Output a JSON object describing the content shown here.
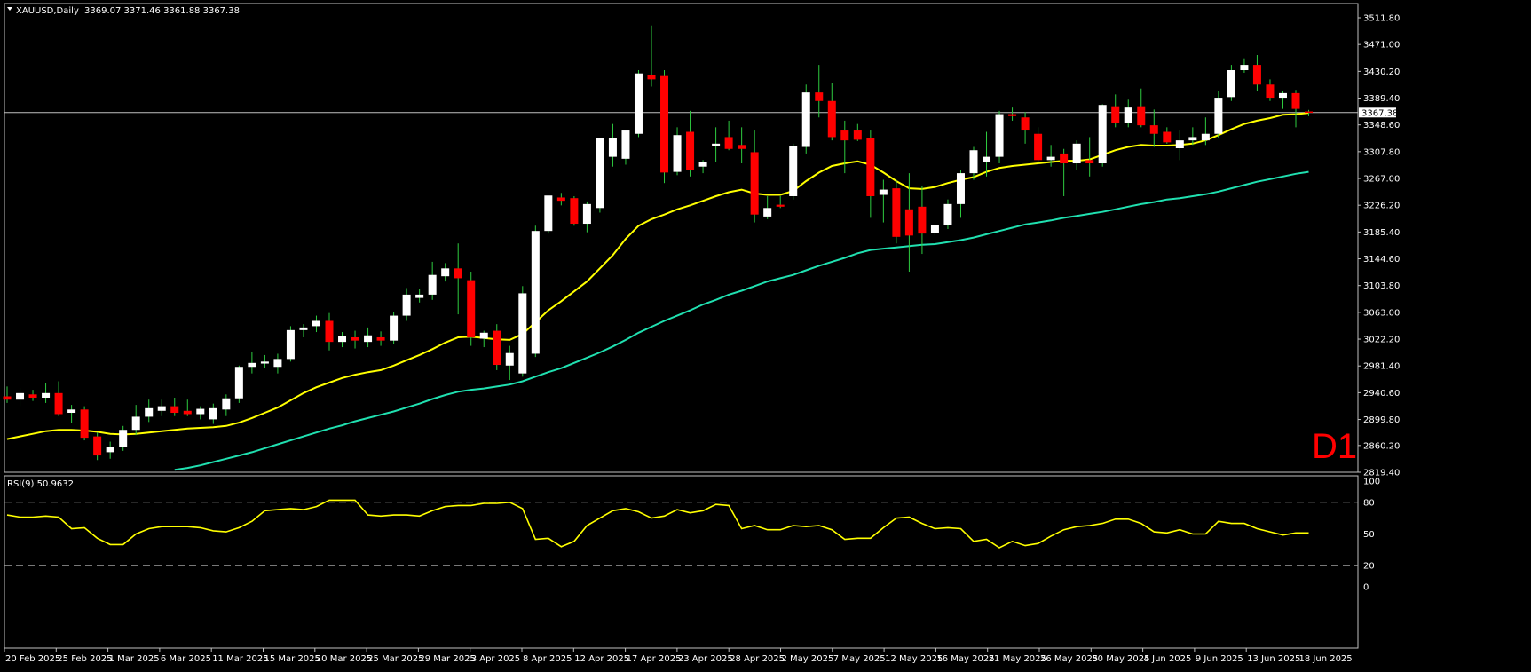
{
  "header": {
    "symbol": "XAUUSD,Daily",
    "ohlc": "3369.07 3371.46 3361.88 3367.38",
    "timeframe": "D1"
  },
  "price_axis": {
    "labels": [
      "3511.80",
      "3471.00",
      "3430.20",
      "3389.40",
      "3348.60",
      "3307.80",
      "3267.00",
      "3226.20",
      "3185.40",
      "3144.60",
      "3103.80",
      "3063.00",
      "3022.20",
      "2981.40",
      "2940.60",
      "2899.80",
      "2860.20",
      "2819.40"
    ],
    "current_price": "3367.38",
    "ylim": [
      2819.4,
      3511.8
    ]
  },
  "rsi": {
    "label": "RSI(9) 50.9632",
    "levels": [
      0,
      20,
      50,
      80,
      100
    ],
    "level_labels": [
      "100",
      "80",
      "50",
      "20",
      "0"
    ]
  },
  "date_axis": {
    "labels": [
      "20 Feb 2025",
      "25 Feb 2025",
      "1 Mar 2025",
      "6 Mar 2025",
      "11 Mar 2025",
      "15 Mar 2025",
      "20 Mar 2025",
      "25 Mar 2025",
      "29 Mar 2025",
      "3 Apr 2025",
      "8 Apr 2025",
      "12 Apr 2025",
      "17 Apr 2025",
      "23 Apr 2025",
      "28 Apr 2025",
      "2 May 2025",
      "7 May 2025",
      "12 May 2025",
      "16 May 2025",
      "21 May 2025",
      "26 May 2025",
      "30 May 2025",
      "4 Jun 2025",
      "9 Jun 2025",
      "13 Jun 2025",
      "18 Jun 2025"
    ]
  },
  "colors": {
    "bull": "#ffffff",
    "bear": "#ff0000",
    "ma_fast": "#ffff00",
    "ma_slow": "#20e0b0",
    "rsi": "#ffff00",
    "frame": "#c0c0c0"
  },
  "chart_data": {
    "type": "candlestick",
    "ohlc": [
      [
        2935,
        2950,
        2925,
        2930
      ],
      [
        2930,
        2948,
        2920,
        2940
      ],
      [
        2938,
        2945,
        2928,
        2933
      ],
      [
        2933,
        2955,
        2925,
        2940
      ],
      [
        2940,
        2958,
        2905,
        2908
      ],
      [
        2910,
        2922,
        2895,
        2915
      ],
      [
        2915,
        2920,
        2868,
        2872
      ],
      [
        2874,
        2880,
        2838,
        2845
      ],
      [
        2850,
        2866,
        2840,
        2858
      ],
      [
        2858,
        2890,
        2852,
        2884
      ],
      [
        2884,
        2922,
        2876,
        2904
      ],
      [
        2904,
        2930,
        2896,
        2917
      ],
      [
        2913,
        2930,
        2905,
        2920
      ],
      [
        2920,
        2933,
        2905,
        2910
      ],
      [
        2913,
        2930,
        2905,
        2908
      ],
      [
        2908,
        2920,
        2900,
        2916
      ],
      [
        2900,
        2924,
        2893,
        2917
      ],
      [
        2915,
        2938,
        2905,
        2932
      ],
      [
        2932,
        2982,
        2925,
        2980
      ],
      [
        2980,
        3003,
        2970,
        2986
      ],
      [
        2985,
        2998,
        2978,
        2988
      ],
      [
        2980,
        3000,
        2970,
        2992
      ],
      [
        2992,
        3042,
        2988,
        3036
      ],
      [
        3036,
        3045,
        3025,
        3040
      ],
      [
        3042,
        3058,
        3033,
        3050
      ],
      [
        3050,
        3062,
        3005,
        3018
      ],
      [
        3018,
        3033,
        3010,
        3027
      ],
      [
        3025,
        3035,
        3008,
        3020
      ],
      [
        3018,
        3040,
        3010,
        3028
      ],
      [
        3025,
        3034,
        3012,
        3020
      ],
      [
        3020,
        3064,
        3015,
        3058
      ],
      [
        3058,
        3100,
        3050,
        3090
      ],
      [
        3085,
        3098,
        3078,
        3090
      ],
      [
        3090,
        3140,
        3082,
        3120
      ],
      [
        3118,
        3138,
        3110,
        3130
      ],
      [
        3130,
        3168,
        3060,
        3115
      ],
      [
        3112,
        3125,
        3012,
        3025
      ],
      [
        3023,
        3035,
        3010,
        3032
      ],
      [
        3035,
        3045,
        2975,
        2983
      ],
      [
        2982,
        3012,
        2960,
        3001
      ],
      [
        2970,
        3103,
        2965,
        3092
      ],
      [
        3000,
        3195,
        2995,
        3187
      ],
      [
        3187,
        3240,
        3183,
        3241
      ],
      [
        3238,
        3245,
        3226,
        3233
      ],
      [
        3237,
        3240,
        3195,
        3198
      ],
      [
        3198,
        3232,
        3185,
        3228
      ],
      [
        3222,
        3328,
        3215,
        3328
      ],
      [
        3300,
        3350,
        3285,
        3328
      ],
      [
        3297,
        3330,
        3288,
        3340
      ],
      [
        3335,
        3432,
        3330,
        3427
      ],
      [
        3425,
        3500,
        3407,
        3418
      ],
      [
        3423,
        3432,
        3260,
        3276
      ],
      [
        3277,
        3345,
        3272,
        3333
      ],
      [
        3338,
        3370,
        3270,
        3280
      ],
      [
        3285,
        3295,
        3275,
        3292
      ],
      [
        3317,
        3345,
        3292,
        3320
      ],
      [
        3330,
        3355,
        3310,
        3312
      ],
      [
        3318,
        3345,
        3290,
        3312
      ],
      [
        3307,
        3340,
        3200,
        3212
      ],
      [
        3209,
        3240,
        3205,
        3222
      ],
      [
        3227,
        3240,
        3222,
        3224
      ],
      [
        3240,
        3320,
        3235,
        3316
      ],
      [
        3315,
        3410,
        3305,
        3398
      ],
      [
        3398,
        3440,
        3360,
        3385
      ],
      [
        3385,
        3412,
        3325,
        3330
      ],
      [
        3340,
        3355,
        3275,
        3325
      ],
      [
        3340,
        3350,
        3324,
        3326
      ],
      [
        3328,
        3340,
        3207,
        3240
      ],
      [
        3242,
        3265,
        3200,
        3250
      ],
      [
        3252,
        3265,
        3168,
        3178
      ],
      [
        3220,
        3275,
        3125,
        3180
      ],
      [
        3224,
        3255,
        3152,
        3183
      ],
      [
        3184,
        3197,
        3180,
        3196
      ],
      [
        3196,
        3235,
        3190,
        3228
      ],
      [
        3228,
        3280,
        3207,
        3275
      ],
      [
        3275,
        3315,
        3265,
        3310
      ],
      [
        3292,
        3338,
        3270,
        3300
      ],
      [
        3300,
        3370,
        3290,
        3365
      ],
      [
        3365,
        3375,
        3355,
        3362
      ],
      [
        3360,
        3368,
        3320,
        3340
      ],
      [
        3335,
        3345,
        3288,
        3295
      ],
      [
        3295,
        3318,
        3285,
        3300
      ],
      [
        3305,
        3312,
        3240,
        3290
      ],
      [
        3290,
        3325,
        3280,
        3320
      ],
      [
        3295,
        3330,
        3270,
        3290
      ],
      [
        3290,
        3380,
        3285,
        3379
      ],
      [
        3377,
        3395,
        3345,
        3352
      ],
      [
        3352,
        3387,
        3345,
        3375
      ],
      [
        3377,
        3404,
        3345,
        3348
      ],
      [
        3348,
        3372,
        3315,
        3335
      ],
      [
        3338,
        3345,
        3320,
        3322
      ],
      [
        3313,
        3340,
        3295,
        3325
      ],
      [
        3325,
        3345,
        3318,
        3330
      ],
      [
        3325,
        3360,
        3318,
        3335
      ],
      [
        3335,
        3400,
        3328,
        3390
      ],
      [
        3391,
        3440,
        3385,
        3432
      ],
      [
        3432,
        3450,
        3428,
        3440
      ],
      [
        3440,
        3455,
        3400,
        3410
      ],
      [
        3410,
        3418,
        3385,
        3390
      ],
      [
        3390,
        3400,
        3373,
        3397
      ],
      [
        3397,
        3402,
        3345,
        3373
      ],
      [
        3369.07,
        3371.46,
        3361.88,
        3367.38
      ]
    ],
    "ma_fast": [
      2870,
      2874,
      2878,
      2882,
      2884,
      2884,
      2883,
      2881,
      2878,
      2877,
      2878,
      2880,
      2882,
      2884,
      2886,
      2887,
      2888,
      2890,
      2895,
      2902,
      2910,
      2918,
      2929,
      2940,
      2949,
      2956,
      2963,
      2968,
      2972,
      2975,
      2982,
      2990,
      2998,
      3007,
      3017,
      3025,
      3026,
      3024,
      3022,
      3021,
      3030,
      3048,
      3066,
      3080,
      3095,
      3110,
      3130,
      3150,
      3175,
      3195,
      3205,
      3212,
      3220,
      3226,
      3233,
      3240,
      3246,
      3250,
      3244,
      3242,
      3242,
      3248,
      3263,
      3276,
      3286,
      3290,
      3293,
      3288,
      3276,
      3263,
      3252,
      3251,
      3254,
      3260,
      3265,
      3269,
      3277,
      3283,
      3286,
      3288,
      3290,
      3292,
      3294,
      3294,
      3296,
      3303,
      3310,
      3315,
      3318,
      3317,
      3317,
      3318,
      3320,
      3325,
      3333,
      3342,
      3350,
      3355,
      3359,
      3364,
      3365,
      3367
    ],
    "ma_slow": [
      2780,
      2783,
      2786,
      2789,
      2792,
      2795,
      2798,
      2801,
      2805,
      2808,
      2811,
      2815,
      2819,
      2823,
      2826,
      2830,
      2835,
      2840,
      2845,
      2850,
      2856,
      2862,
      2868,
      2874,
      2880,
      2886,
      2891,
      2897,
      2902,
      2907,
      2912,
      2918,
      2924,
      2931,
      2937,
      2942,
      2945,
      2947,
      2950,
      2953,
      2958,
      2965,
      2972,
      2978,
      2986,
      2994,
      3002,
      3011,
      3021,
      3032,
      3041,
      3050,
      3058,
      3066,
      3075,
      3082,
      3090,
      3096,
      3103,
      3110,
      3115,
      3120,
      3127,
      3134,
      3140,
      3146,
      3153,
      3158,
      3160,
      3162,
      3164,
      3166,
      3167,
      3170,
      3173,
      3177,
      3182,
      3187,
      3192,
      3197,
      3200,
      3203,
      3207,
      3210,
      3213,
      3216,
      3220,
      3224,
      3228,
      3231,
      3235,
      3237,
      3240,
      3243,
      3247,
      3252,
      3257,
      3262,
      3266,
      3270,
      3274,
      3277
    ],
    "rsi": [
      68,
      66,
      66,
      67,
      66,
      55,
      56,
      46,
      40,
      40,
      50,
      55,
      57,
      57,
      57,
      56,
      53,
      52,
      56,
      62,
      72,
      73,
      74,
      73,
      76,
      82,
      82,
      82,
      68,
      67,
      68,
      68,
      67,
      72,
      76,
      77,
      77,
      79,
      79,
      80,
      74,
      45,
      46,
      38,
      43,
      58,
      65,
      72,
      74,
      71,
      65,
      67,
      73,
      70,
      72,
      78,
      77,
      55,
      58,
      54,
      54,
      58,
      57,
      58,
      54,
      45,
      46,
      46,
      56,
      65,
      66,
      60,
      55,
      56,
      55,
      43,
      45,
      37,
      43,
      39,
      41,
      48,
      54,
      57,
      58,
      60,
      64,
      64,
      60,
      52,
      51,
      54,
      50,
      50,
      62,
      60,
      60,
      55,
      52,
      49,
      51,
      51
    ],
    "price_ylim": [
      2819.4,
      3511.8
    ],
    "rsi_ylim": [
      0,
      100
    ]
  }
}
